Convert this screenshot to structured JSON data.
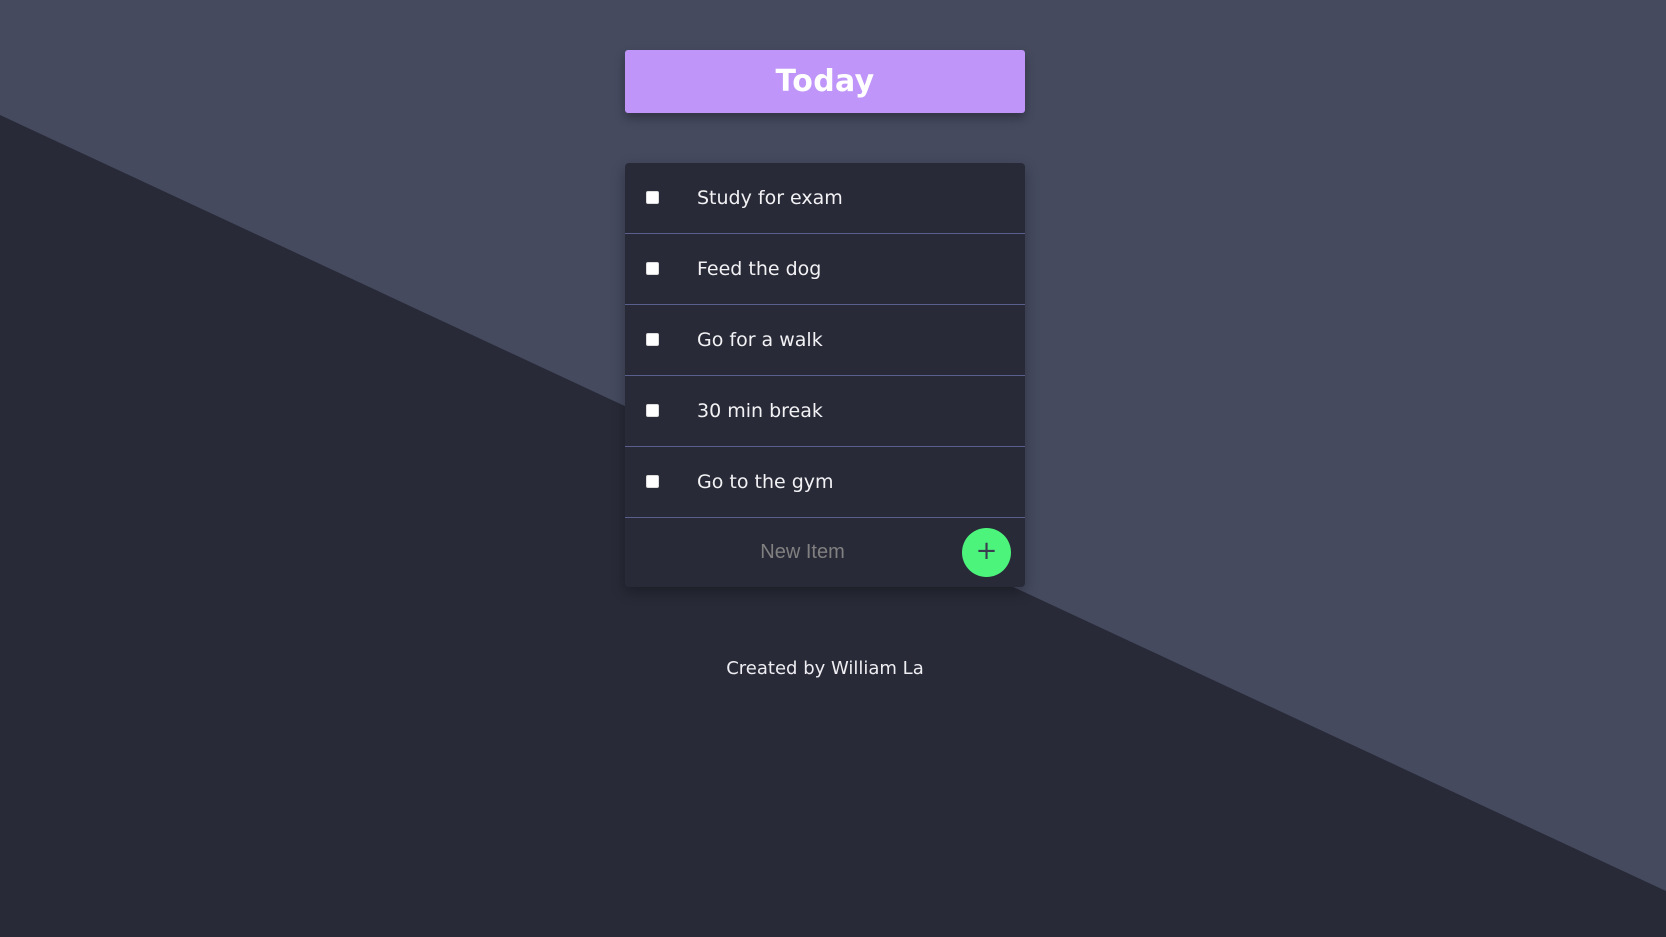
{
  "colors": {
    "background_light": "#454a5f",
    "background_dark": "#282a37",
    "heading_accent": "#bf95f9",
    "add_button": "#4cf47c",
    "divider": "#5a5f8e"
  },
  "heading": {
    "title": "Today"
  },
  "todo": {
    "items": [
      {
        "label": "Study for exam",
        "checked": false
      },
      {
        "label": "Feed the dog",
        "checked": false
      },
      {
        "label": "Go for a walk",
        "checked": false
      },
      {
        "label": "30 min break",
        "checked": false
      },
      {
        "label": "Go to the gym",
        "checked": false
      }
    ],
    "new_item": {
      "placeholder": "New Item",
      "value": "",
      "add_icon": "plus-icon",
      "add_label": "+"
    }
  },
  "footer": {
    "text": "Created by William La"
  }
}
